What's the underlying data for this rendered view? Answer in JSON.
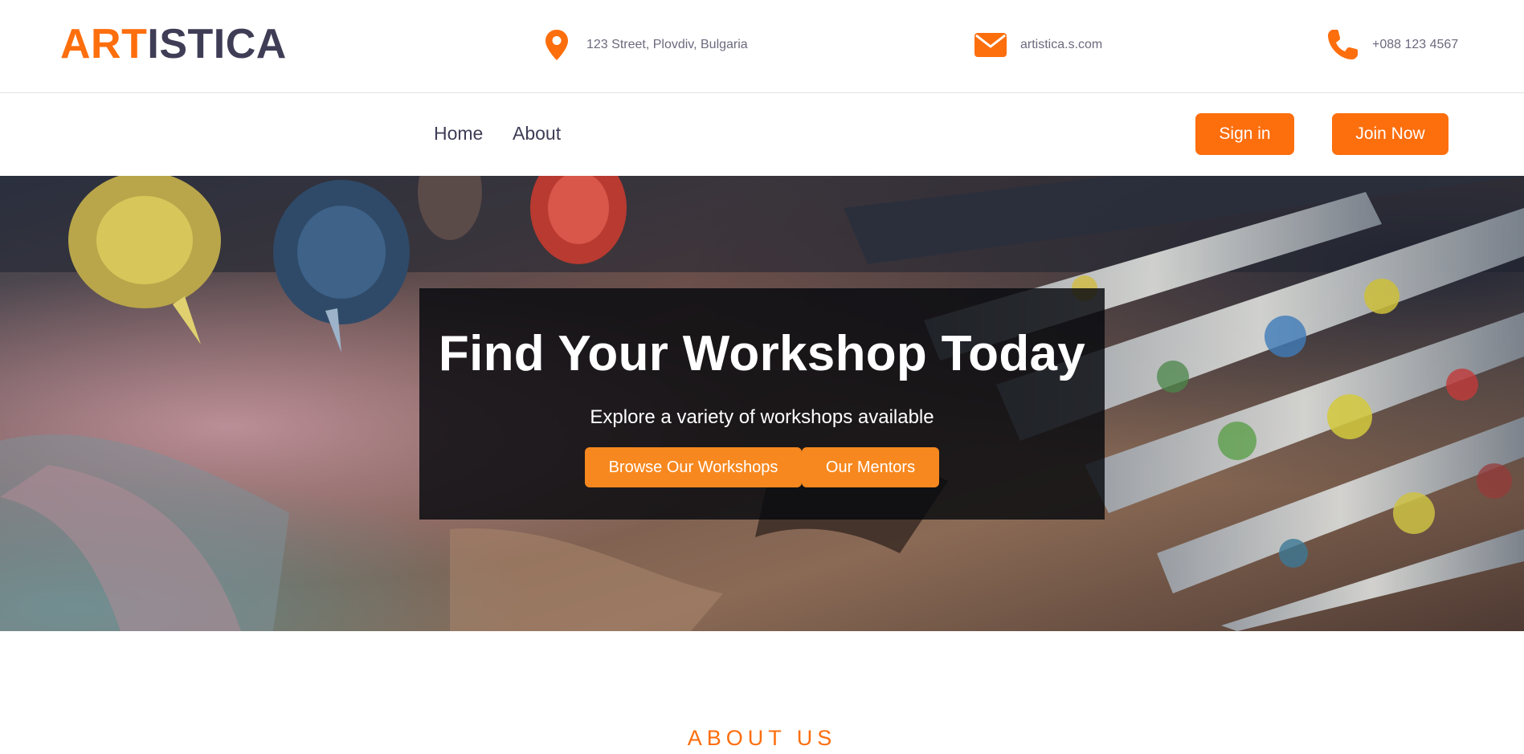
{
  "brand": {
    "logo_part1": "ART",
    "logo_part2": "ISTICA",
    "accent": "#fd6e0d",
    "dark": "#3f3d56"
  },
  "contacts": {
    "address": {
      "icon": "map-pin-icon",
      "text": "123 Street, Plovdiv, Bulgaria"
    },
    "email": {
      "icon": "envelope-icon",
      "text": "artistica.s.com"
    },
    "phone": {
      "icon": "phone-icon",
      "text": "+088 123 4567"
    }
  },
  "nav": {
    "links": [
      "Home",
      "About"
    ],
    "signin_label": "Sign in",
    "join_label": "Join Now"
  },
  "hero": {
    "title": "Find Your Workshop Today",
    "subtitle": "Explore a variety of workshops available",
    "browse_label": "Browse Our Workshops",
    "mentors_label": "Our Mentors",
    "button_color": "#f7881f"
  },
  "about": {
    "heading": "ABOUT US"
  }
}
